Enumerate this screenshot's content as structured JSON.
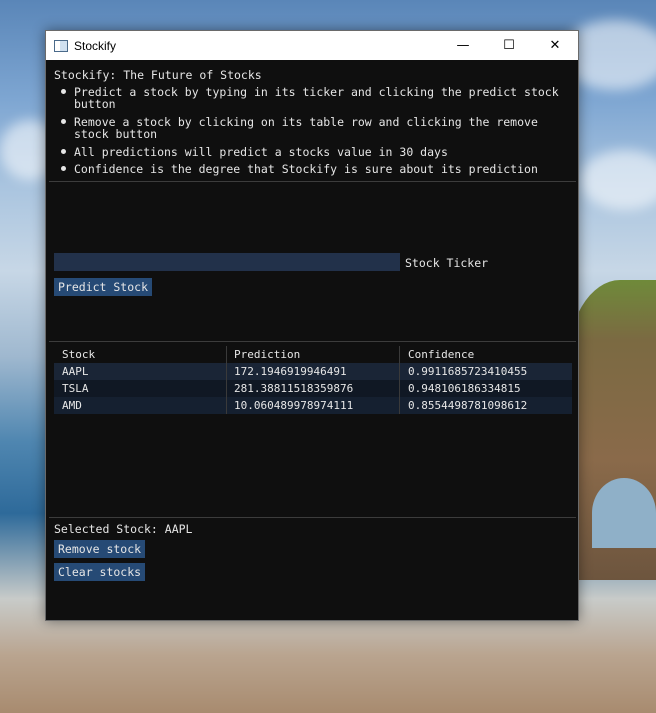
{
  "window": {
    "title": "Stockify",
    "controls": {
      "minimize": "—",
      "maximize": "☐",
      "close": "✕"
    }
  },
  "intro": {
    "heading": "Stockify: The Future of Stocks",
    "bullets": [
      "Predict a stock by typing in its ticker and clicking the predict stock button",
      "Remove a stock by clicking on its table row and clicking the remove stock button",
      "All predictions will predict a stocks value in 30 days",
      "Confidence is the degree that Stockify is sure about its prediction"
    ]
  },
  "form": {
    "ticker_value": "",
    "ticker_label": "Stock Ticker",
    "predict_label": "Predict Stock"
  },
  "table": {
    "headers": [
      "Stock",
      "Prediction",
      "Confidence"
    ],
    "rows": [
      [
        "AAPL",
        "172.1946919946491",
        "0.9911685723410455"
      ],
      [
        "TSLA",
        "281.38811518359876",
        "0.948106186334815"
      ],
      [
        "AMD",
        "10.060489978974111",
        "0.8554498781098612"
      ]
    ]
  },
  "selection": {
    "text": "Selected Stock: AAPL",
    "remove_label": "Remove stock",
    "clear_label": "Clear stocks"
  }
}
